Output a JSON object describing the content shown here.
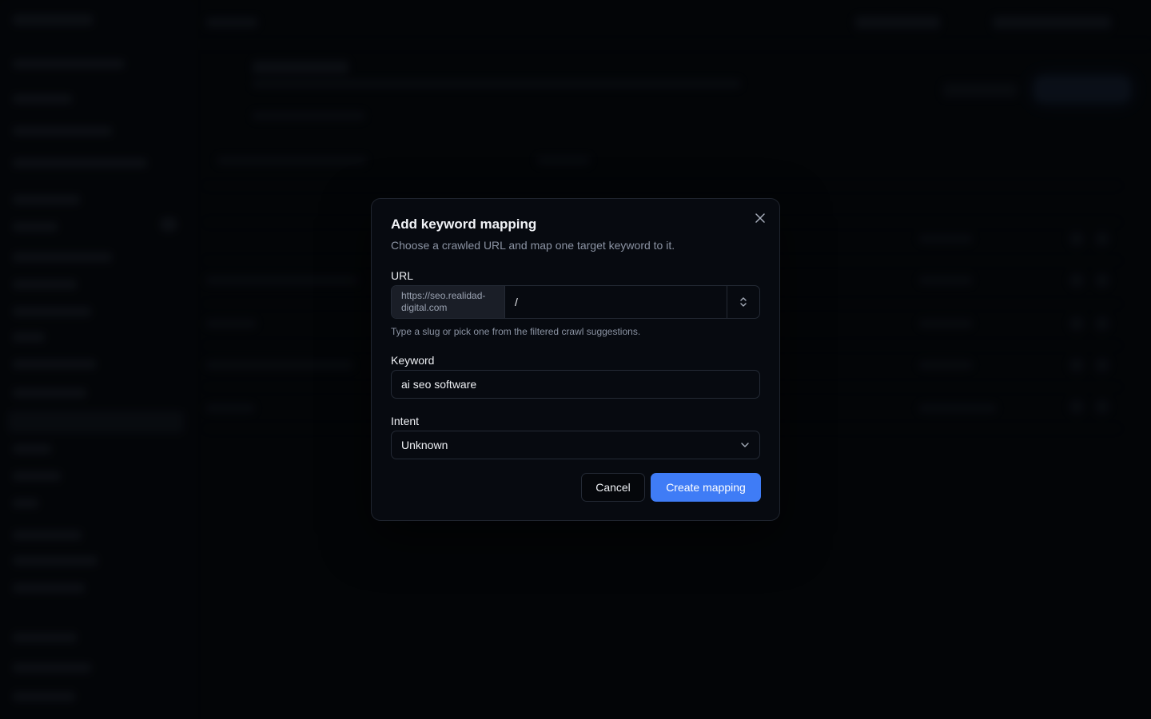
{
  "modal": {
    "title": "Add keyword mapping",
    "subtitle": "Choose a crawled URL and map one target keyword to it.",
    "url_label": "URL",
    "url_prefix": "https://seo.realidad-digital.com",
    "url_value": "/",
    "url_hint": "Type a slug or pick one from the filtered crawl suggestions.",
    "keyword_label": "Keyword",
    "keyword_value": "ai seo software",
    "intent_label": "Intent",
    "intent_value": "Unknown",
    "cancel_label": "Cancel",
    "create_label": "Create mapping"
  },
  "colors": {
    "accent": "#3f7cf6",
    "modal_bg": "#070a10",
    "border": "#242a35"
  },
  "icons": {
    "close": "close-icon",
    "url_toggle": "chevrons-up-down-icon",
    "intent_toggle": "chevron-down-icon"
  }
}
